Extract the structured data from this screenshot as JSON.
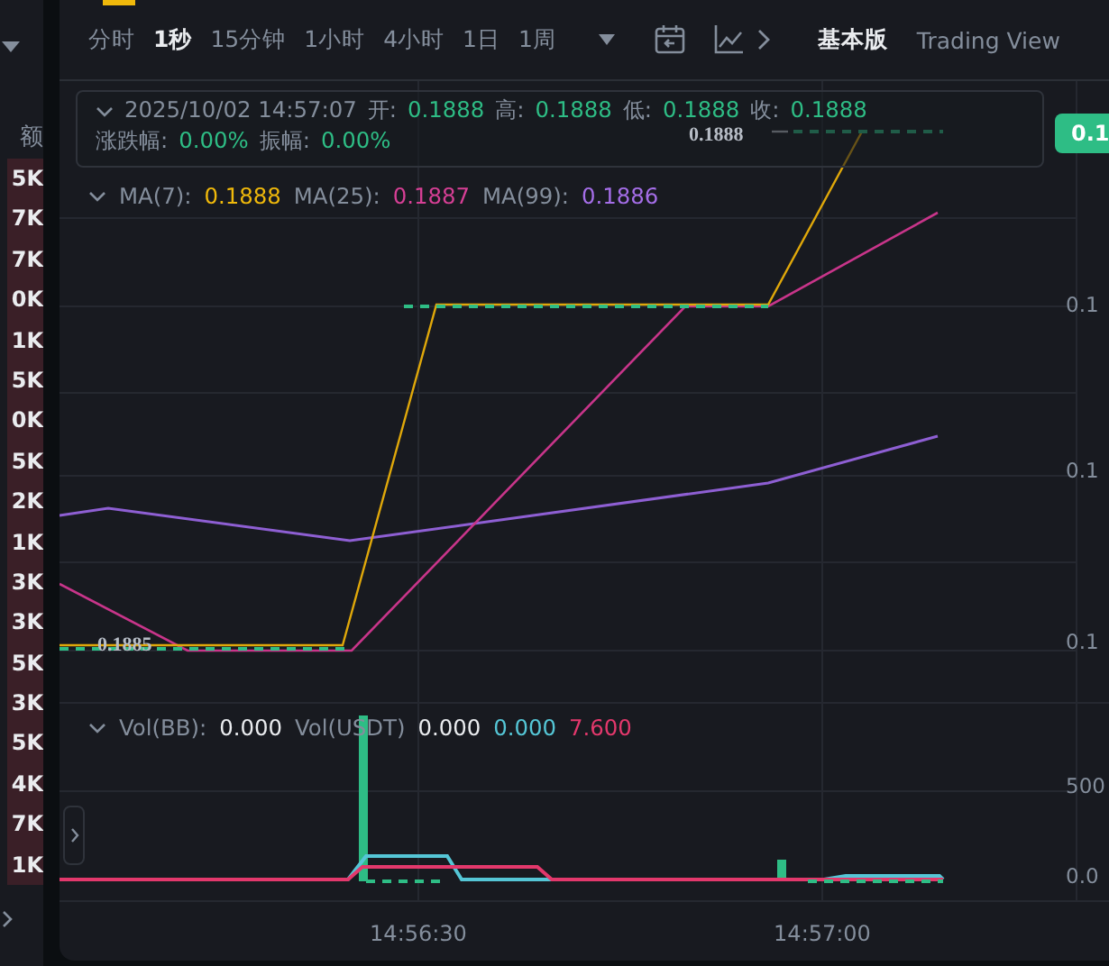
{
  "order_book": {
    "header": "额",
    "values": [
      "5K",
      "7K",
      "7K",
      "0K",
      "1K",
      "5K",
      "0K",
      "5K",
      "2K",
      "1K",
      "3K",
      "3K",
      "5K",
      "3K",
      "5K",
      "4K",
      "7K",
      "1K"
    ]
  },
  "toolbar": {
    "intervals": [
      {
        "label": "分时",
        "selected": false
      },
      {
        "label": "1秒",
        "selected": true
      },
      {
        "label": "15分钟",
        "selected": false
      },
      {
        "label": "1小时",
        "selected": false
      },
      {
        "label": "4小时",
        "selected": false
      },
      {
        "label": "1日",
        "selected": false
      },
      {
        "label": "1周",
        "selected": false
      }
    ],
    "views": [
      {
        "label": "基本版",
        "selected": true
      },
      {
        "label": "Trading View",
        "selected": false
      }
    ]
  },
  "ohlc": {
    "time": "2025/10/02 14:57:07",
    "fields": [
      {
        "label": "开:",
        "value": "0.1888"
      },
      {
        "label": "高:",
        "value": "0.1888"
      },
      {
        "label": "低:",
        "value": "0.1888"
      },
      {
        "label": "收:",
        "value": "0.1888"
      },
      {
        "label": "涨跌幅:",
        "value": "0.00%"
      },
      {
        "label": "振幅:",
        "value": "0.00%"
      }
    ]
  },
  "ma": [
    {
      "label": "MA(7):",
      "value": "0.1888",
      "color": "#f0b90b"
    },
    {
      "label": "MA(25):",
      "value": "0.1887",
      "color": "#d63f95"
    },
    {
      "label": "MA(99):",
      "value": "0.1886",
      "color": "#a56ee8"
    }
  ],
  "price_tag": "0.1",
  "price_axis": [
    "0.1",
    "0.1",
    "0.1"
  ],
  "line_labels": [
    "0.1888",
    "0.1885"
  ],
  "volume": {
    "legend": [
      {
        "text": "Vol(BB):",
        "color": "#848e9c"
      },
      {
        "text": "0.000",
        "color": "#eaecef"
      },
      {
        "text": "Vol(USDT)",
        "color": "#848e9c"
      },
      {
        "text": "0.000",
        "color": "#eaecef"
      },
      {
        "text": "0.000",
        "color": "#55c6d6"
      },
      {
        "text": "7.600",
        "color": "#e3386c"
      }
    ],
    "axis": [
      "500",
      "0.0"
    ]
  },
  "time_axis": [
    "14:56:30",
    "14:57:00"
  ]
}
